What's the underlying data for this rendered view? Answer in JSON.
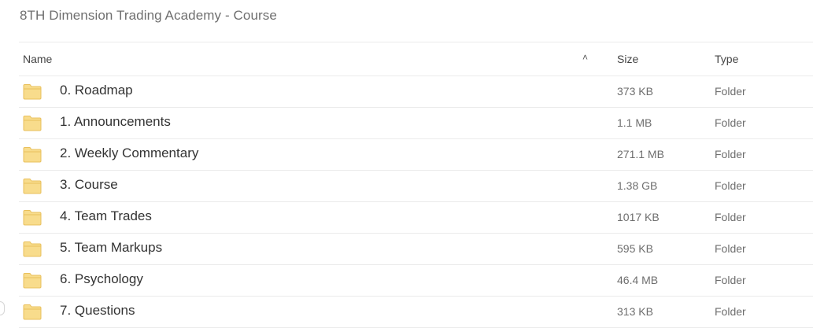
{
  "title": "8TH Dimension Trading Academy - Course",
  "columns": {
    "name": "Name",
    "size": "Size",
    "type": "Type",
    "sort_icon": "chevron-up-icon"
  },
  "rows": [
    {
      "name": "0. Roadmap",
      "size": "373 KB",
      "type": "Folder"
    },
    {
      "name": "1. Announcements",
      "size": "1.1 MB",
      "type": "Folder"
    },
    {
      "name": "2. Weekly Commentary",
      "size": "271.1 MB",
      "type": "Folder"
    },
    {
      "name": "3. Course",
      "size": "1.38 GB",
      "type": "Folder"
    },
    {
      "name": "4. Team Trades",
      "size": "1017 KB",
      "type": "Folder"
    },
    {
      "name": "5. Team Markups",
      "size": "595 KB",
      "type": "Folder"
    },
    {
      "name": "6. Psychology",
      "size": "46.4 MB",
      "type": "Folder"
    },
    {
      "name": "7. Questions",
      "size": "313 KB",
      "type": "Folder"
    }
  ],
  "colors": {
    "folder_fill": "#f8dc8c",
    "folder_stroke": "#e9c05c"
  }
}
